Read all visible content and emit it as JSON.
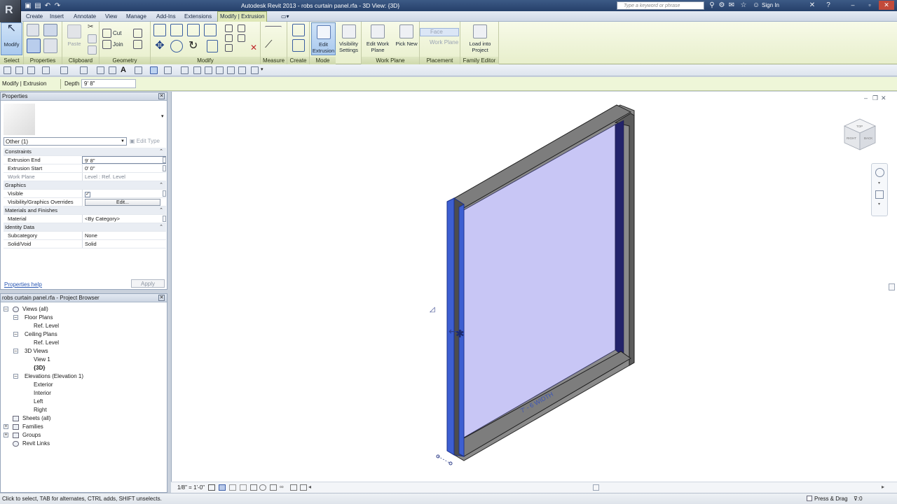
{
  "title_bar": {
    "title": "Autodesk Revit 2013  -  robs curtain panel.rfa - 3D View: {3D}",
    "search_placeholder": "Type a keyword or phrase",
    "sign_in": "Sign In"
  },
  "ribbon_tabs": [
    "Create",
    "Insert",
    "Annotate",
    "View",
    "Manage",
    "Add-Ins",
    "Extensions",
    "Modify | Extrusion"
  ],
  "ribbon": {
    "select": {
      "label": "Select",
      "modify": "Modify"
    },
    "properties": {
      "label": "Properties"
    },
    "clipboard": {
      "label": "Clipboard",
      "paste": "Paste"
    },
    "geometry": {
      "label": "Geometry",
      "cut": "Cut",
      "join": "Join"
    },
    "modify": {
      "label": "Modify"
    },
    "measure": {
      "label": "Measure"
    },
    "create": {
      "label": "Create"
    },
    "mode": {
      "label": "Mode",
      "edit_extrusion": "Edit Extrusion"
    },
    "visibility": {
      "label": "Visibility Settings"
    },
    "work_plane": {
      "label": "Work Plane",
      "edit": "Edit Work Plane",
      "pick_new": "Pick New"
    },
    "placement": {
      "label": "Placement",
      "face": "Face",
      "work_plane": "Work Plane"
    },
    "family_editor": {
      "label": "Family Editor",
      "load": "Load into Project"
    }
  },
  "options_bar": {
    "context": "Modify | Extrusion",
    "depth_label": "Depth",
    "depth_value": "9'  8\""
  },
  "properties": {
    "title": "Properties",
    "filter": "Other (1)",
    "edit_type": "Edit Type",
    "groups": [
      {
        "name": "Constraints",
        "rows": [
          {
            "name": "Extrusion End",
            "value": "9'  8\""
          },
          {
            "name": "Extrusion Start",
            "value": "0'  0\""
          },
          {
            "name": "Work Plane",
            "value": "Level : Ref. Level"
          }
        ]
      },
      {
        "name": "Graphics",
        "rows": [
          {
            "name": "Visible",
            "value": "✓"
          },
          {
            "name": "Visibility/Graphics Overrides",
            "value": "Edit..."
          }
        ]
      },
      {
        "name": "Materials and Finishes",
        "rows": [
          {
            "name": "Material",
            "value": "<By Category>"
          }
        ]
      },
      {
        "name": "Identity Data",
        "rows": [
          {
            "name": "Subcategory",
            "value": "None"
          },
          {
            "name": "Solid/Void",
            "value": "Solid"
          }
        ]
      }
    ],
    "help": "Properties help",
    "apply": "Apply"
  },
  "project_browser": {
    "title": "robs curtain panel.rfa - Project Browser",
    "nodes": [
      "Views (all)",
      "Floor Plans",
      "Ref. Level",
      "Ceiling Plans",
      "Ref. Level",
      "3D Views",
      "View 1",
      "{3D}",
      "Elevations (Elevation 1)",
      "Exterior",
      "Interior",
      "Left",
      "Right",
      "Sheets (all)",
      "Families",
      "Groups",
      "Revit Links"
    ]
  },
  "viewport": {
    "scale": "1/8\" = 1'-0\"",
    "dimension_text": "7' - 6  WIDTH",
    "viewcube_faces": [
      "TOP",
      "RIGHT",
      "BACK"
    ]
  },
  "status": {
    "text": "Click to select, TAB for alternates, CTRL adds, SHIFT unselects.",
    "press_drag": "Press & Drag",
    "filter_count": ":0"
  },
  "colors": {
    "ribbon_context": "#e8efcc",
    "glass": "#c8c6f5",
    "frame": "#6c6c6c",
    "selection": "#3d5fd1"
  }
}
